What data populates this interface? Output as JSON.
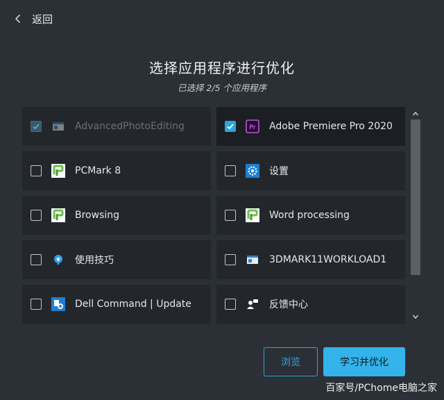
{
  "nav": {
    "back_label": "返回"
  },
  "header": {
    "title": "选择应用程序进行优化",
    "subtitle": "已选择 2/5 个应用程序"
  },
  "apps": [
    {
      "label": "AdvancedPhotoEditing",
      "checked": true,
      "disabled": true,
      "icon": "window-icon"
    },
    {
      "label": "Adobe Premiere Pro 2020",
      "checked": true,
      "disabled": false,
      "icon": "premiere-icon",
      "icon_text": "Pr"
    },
    {
      "label": "PCMark 8",
      "checked": false,
      "disabled": false,
      "icon": "pcmark-icon"
    },
    {
      "label": "设置",
      "checked": false,
      "disabled": false,
      "icon": "gear-icon"
    },
    {
      "label": "Browsing",
      "checked": false,
      "disabled": false,
      "icon": "pcmark-icon"
    },
    {
      "label": "Word processing",
      "checked": false,
      "disabled": false,
      "icon": "pcmark-icon"
    },
    {
      "label": "使用技巧",
      "checked": false,
      "disabled": false,
      "icon": "lightbulb-icon"
    },
    {
      "label": "3DMARK11WORKLOAD1",
      "checked": false,
      "disabled": false,
      "icon": "window-icon"
    },
    {
      "label": "Dell Command | Update",
      "checked": false,
      "disabled": false,
      "icon": "dell-update-icon"
    },
    {
      "label": "反馈中心",
      "checked": false,
      "disabled": false,
      "icon": "feedback-icon"
    }
  ],
  "actions": {
    "browse_label": "浏览",
    "learn_label": "学习并优化"
  },
  "watermark": "百家号/PChome电脑之家",
  "colors": {
    "background": "#2b3036",
    "tile": "#23272c",
    "tile_selected": "#1b1e22",
    "accent": "#2aa6e0",
    "primary_button": "#34b3ea"
  }
}
